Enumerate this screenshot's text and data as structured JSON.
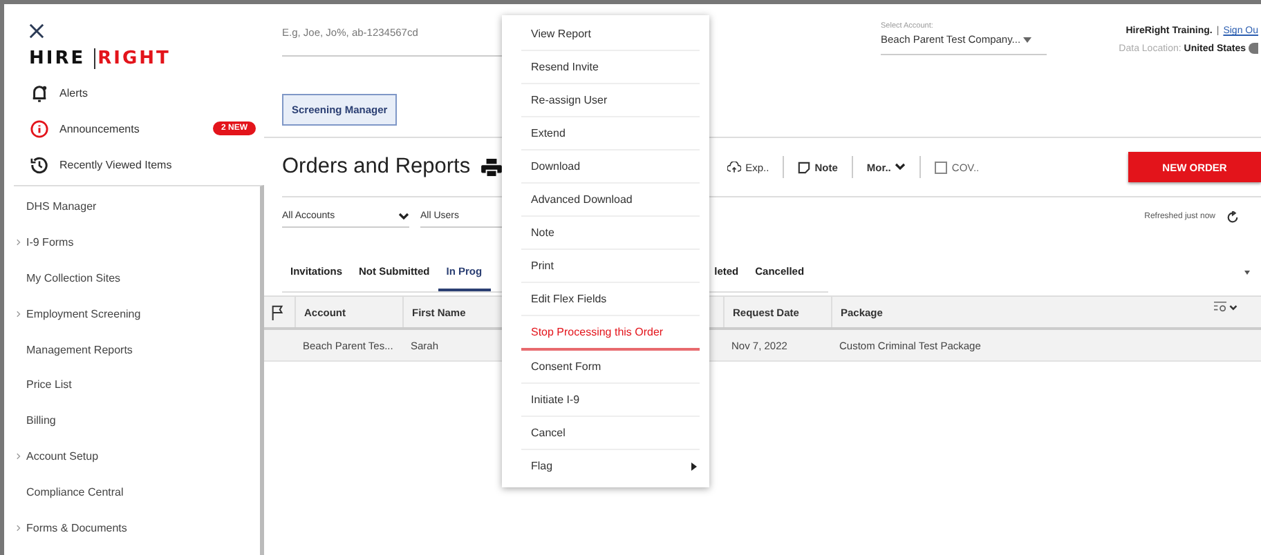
{
  "sidebar": {
    "logo": {
      "first": "HIRE",
      "second": "RIGHT"
    },
    "top_items": [
      {
        "kind": "alerts",
        "label": "Alerts"
      },
      {
        "kind": "announcements",
        "label": "Announcements",
        "badge": "2 NEW"
      },
      {
        "kind": "recent",
        "label": "Recently Viewed Items"
      }
    ],
    "nav_items": [
      {
        "label": "DHS Manager",
        "expandable": false
      },
      {
        "label": "I-9 Forms",
        "expandable": true
      },
      {
        "label": "My Collection Sites",
        "expandable": false
      },
      {
        "label": "Employment Screening",
        "expandable": true
      },
      {
        "label": "Management Reports",
        "expandable": false
      },
      {
        "label": "Price List",
        "expandable": false
      },
      {
        "label": "Billing",
        "expandable": false
      },
      {
        "label": "Account Setup",
        "expandable": true
      },
      {
        "label": "Compliance Central",
        "expandable": false
      },
      {
        "label": "Forms & Documents",
        "expandable": true
      }
    ]
  },
  "header": {
    "search": {
      "placeholder": "E.g, Joe, Jo%, ab-1234567cd"
    },
    "account_select": {
      "label": "Select Account:",
      "value": "Beach Parent Test Company..."
    },
    "user": "HireRight Training.",
    "separator": "|",
    "sign_out": "Sign Ou",
    "data_location": "Data Location: **United States**"
  },
  "screening_manager": "Screening Manager",
  "orders": {
    "title": "Orders and Reports",
    "toolbar": [
      {
        "kind": "export",
        "label": "Exp.."
      },
      {
        "kind": "note",
        "label": "Note"
      },
      {
        "kind": "more",
        "label": "Mor.."
      },
      {
        "kind": "checkbox",
        "label": "COV..",
        "checked": false
      }
    ],
    "new_order": "NEW ORDER",
    "filters": [
      {
        "label": "All Accounts",
        "dropdown": true
      },
      {
        "label": "All Users",
        "dropdown": false
      }
    ],
    "refreshed": "Refreshed just now",
    "tabs": [
      {
        "label": "Invitations",
        "selected": false
      },
      {
        "label": "Not Submitted",
        "selected": false
      },
      {
        "label": "In Prog",
        "selected": true
      },
      {
        "label": "leted",
        "selected": false
      },
      {
        "label": "Cancelled",
        "selected": false
      }
    ],
    "table": {
      "columns": [
        "Account",
        "First Name",
        "",
        "Request Date",
        "Package"
      ],
      "rows": [
        [
          "Beach Parent Tes...",
          "Sarah",
          "",
          "Nov 7, 2022",
          "Custom Criminal Test Package"
        ]
      ]
    }
  },
  "context_menu": [
    {
      "label": "View Report",
      "selected": false,
      "submenu": false
    },
    {
      "label": "Resend Invite",
      "selected": false,
      "submenu": false
    },
    {
      "label": "Re-assign User",
      "selected": false,
      "submenu": false
    },
    {
      "label": "Extend",
      "selected": false,
      "submenu": false
    },
    {
      "label": "Download",
      "selected": false,
      "submenu": false
    },
    {
      "label": "Advanced Download",
      "selected": false,
      "submenu": false
    },
    {
      "label": "Note",
      "selected": false,
      "submenu": false
    },
    {
      "label": "Print",
      "selected": false,
      "submenu": false
    },
    {
      "label": "Edit Flex Fields",
      "selected": false,
      "submenu": false
    },
    {
      "label": "Stop Processing this Order",
      "selected": true,
      "submenu": false
    },
    {
      "label": "Consent Form",
      "selected": false,
      "submenu": false
    },
    {
      "label": "Initiate I-9",
      "selected": false,
      "submenu": false
    },
    {
      "label": "Cancel",
      "selected": false,
      "submenu": false
    },
    {
      "label": "Flag",
      "selected": false,
      "submenu": true
    }
  ]
}
